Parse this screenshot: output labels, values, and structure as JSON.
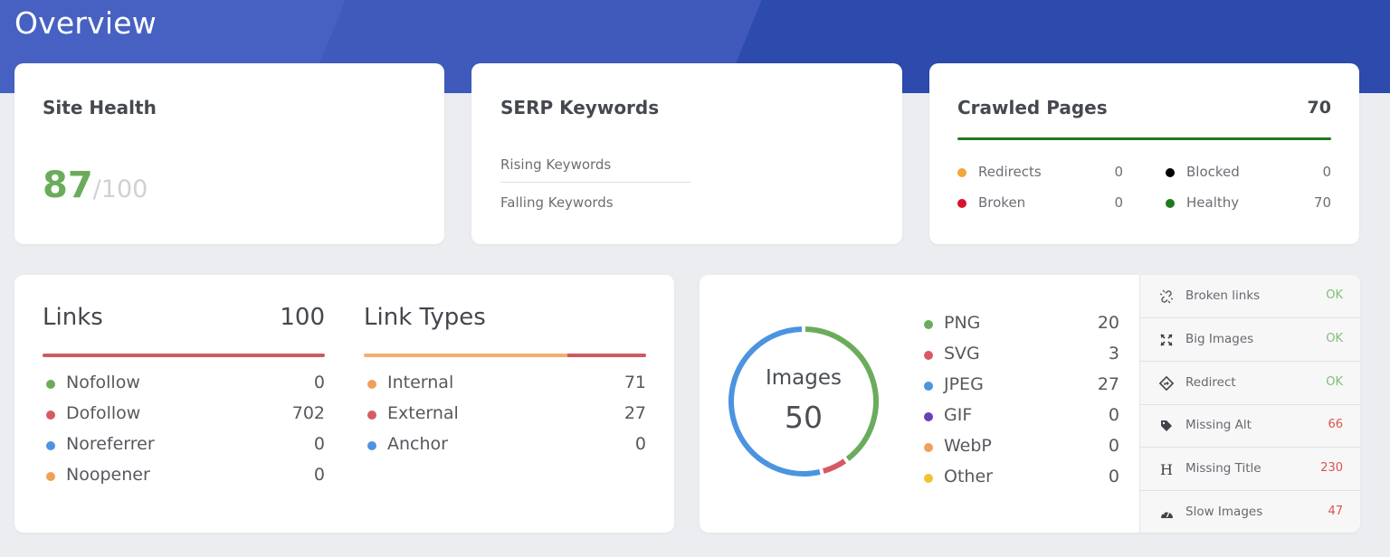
{
  "page_title": "Overview",
  "site_health": {
    "title": "Site Health",
    "score": "87",
    "max": "/100",
    "score_color": "#6aac5c"
  },
  "serp_keywords": {
    "title": "SERP Keywords",
    "rising": "Rising Keywords",
    "falling": "Falling Keywords"
  },
  "crawled_pages": {
    "title": "Crawled Pages",
    "total": "70",
    "bar_color": "#1e7a1e",
    "items": [
      {
        "label": "Redirects",
        "value": "0",
        "color": "#f0a63a"
      },
      {
        "label": "Blocked",
        "value": "0",
        "color": "#000000"
      },
      {
        "label": "Broken",
        "value": "0",
        "color": "#d8132b"
      },
      {
        "label": "Healthy",
        "value": "70",
        "color": "#1e7a1e"
      }
    ]
  },
  "links": {
    "title": "Links",
    "total": "100",
    "bar": [
      {
        "color": "#cd5a5e",
        "fraction": 1.0
      }
    ],
    "items": [
      {
        "label": "Nofollow",
        "value": "0",
        "color": "#6aac5c"
      },
      {
        "label": "Dofollow",
        "value": "702",
        "color": "#d65a64"
      },
      {
        "label": "Noreferrer",
        "value": "0",
        "color": "#4c93e0"
      },
      {
        "label": "Noopener",
        "value": "0",
        "color": "#f0a05a"
      }
    ]
  },
  "link_types": {
    "title": "Link Types",
    "bar": [
      {
        "color": "#efb071",
        "fraction": 0.72
      },
      {
        "color": "#cd5a5e",
        "fraction": 0.28
      }
    ],
    "items": [
      {
        "label": "Internal",
        "value": "71",
        "color": "#f0a05a"
      },
      {
        "label": "External",
        "value": "27",
        "color": "#d65a64"
      },
      {
        "label": "Anchor",
        "value": "0",
        "color": "#4c93e0"
      }
    ]
  },
  "images": {
    "center_title": "Images",
    "center_total": "50",
    "items": [
      {
        "label": "PNG",
        "value": "20",
        "color": "#6aac5c"
      },
      {
        "label": "SVG",
        "value": "3",
        "color": "#d65a64"
      },
      {
        "label": "JPEG",
        "value": "27",
        "color": "#4c93e0"
      },
      {
        "label": "GIF",
        "value": "0",
        "color": "#6a3fb5"
      },
      {
        "label": "WebP",
        "value": "0",
        "color": "#f0a05a"
      },
      {
        "label": "Other",
        "value": "0",
        "color": "#f1c232"
      }
    ]
  },
  "issues": [
    {
      "label": "Broken links",
      "value": "OK",
      "status": "ok",
      "icon": "broken-link-icon"
    },
    {
      "label": "Big Images",
      "value": "OK",
      "status": "ok",
      "icon": "expand-icon"
    },
    {
      "label": "Redirect",
      "value": "OK",
      "status": "ok",
      "icon": "redirect-sign-icon"
    },
    {
      "label": "Missing Alt",
      "value": "66",
      "status": "bad",
      "icon": "tag-icon"
    },
    {
      "label": "Missing Title",
      "value": "230",
      "status": "bad",
      "icon": "heading-icon"
    },
    {
      "label": "Slow Images",
      "value": "47",
      "status": "bad",
      "icon": "speedometer-icon"
    }
  ]
}
